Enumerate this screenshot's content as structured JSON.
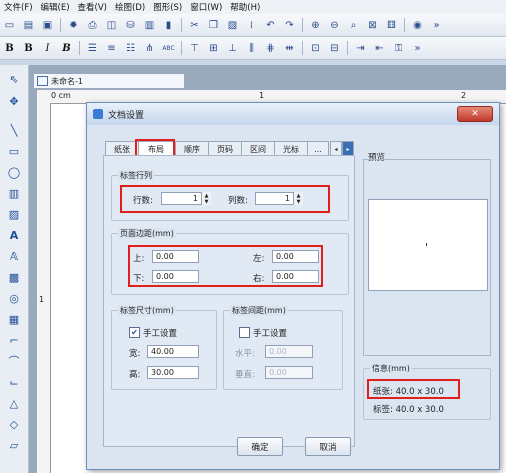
{
  "menubar": [
    "文件(F)",
    "编辑(E)",
    "查看(V)",
    "绘图(D)",
    "图形(S)",
    "窗口(W)",
    "帮助(H)"
  ],
  "toolbar2_text": {
    "bold": "B",
    "italic": "I",
    "bold_italic": "B",
    "abc": "ABC"
  },
  "document": {
    "tab_title": "未命名-1",
    "ruler_left": "0 cm",
    "ruler_mid": "1",
    "ruler_right": "2",
    "ruler_v": "1"
  },
  "dialog": {
    "title": "文档设置",
    "tabs": [
      "纸张",
      "布局",
      "顺序",
      "页码",
      "区间",
      "光标",
      "..."
    ],
    "active_tab": "布局",
    "label_rows_cols": {
      "title": "标签行列",
      "rows_label": "行数:",
      "rows_value": "1",
      "cols_label": "列数:",
      "cols_value": "1"
    },
    "page_margin": {
      "title": "页面边距(mm)",
      "top_label": "上:",
      "top_value": "0.00",
      "left_label": "左:",
      "left_value": "0.00",
      "bottom_label": "下:",
      "bottom_value": "0.00",
      "right_label": "右:",
      "right_value": "0.00"
    },
    "label_size": {
      "title": "标签尺寸(mm)",
      "manual_label": "手工设置",
      "manual_checked": true,
      "width_label": "宽:",
      "width_value": "40.00",
      "height_label": "高:",
      "height_value": "30.00"
    },
    "label_spacing": {
      "title": "标签间距(mm)",
      "manual_label": "手工设置",
      "manual_checked": false,
      "h_label": "水平:",
      "h_value": "0.00",
      "v_label": "垂直:",
      "v_value": "0.00"
    },
    "preview": {
      "title": "预览"
    },
    "info": {
      "title": "信息(mm)",
      "paper": "纸张: 40.0 x 30.0",
      "label": "标签: 40.0 x 30.0"
    },
    "ok_label": "确定",
    "cancel_label": "取消"
  },
  "colors": {
    "highlight": "#e0201c",
    "accent": "#1f4f9a"
  }
}
